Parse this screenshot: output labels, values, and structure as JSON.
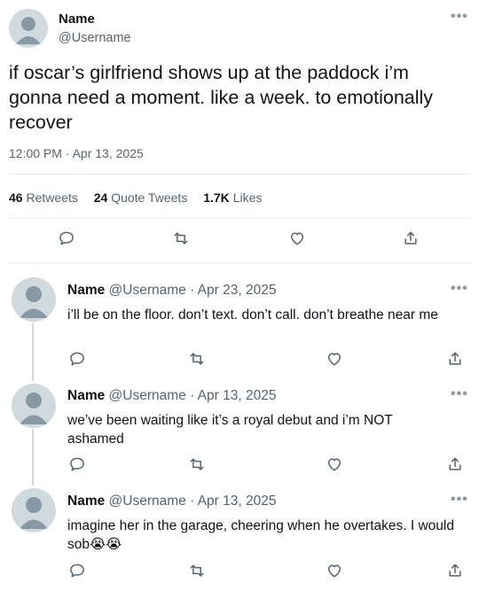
{
  "main_tweet": {
    "name": "Name",
    "username": "@Username",
    "text": "if oscar’s girlfriend shows up at the paddock i’m gonna need a moment. like a week. to emotionally recover",
    "timestamp": "12:00 PM · Apr 13, 2025",
    "stats": {
      "retweets_count": "46",
      "retweets_label": "Retweets",
      "quotes_count": "24",
      "quotes_label": "Quote Tweets",
      "likes_count": "1.7K",
      "likes_label": "Likes"
    },
    "more_label": "•••"
  },
  "replies": [
    {
      "name": "Name",
      "meta": "@Username · Apr 23, 2025",
      "text": "i’ll be on the floor. don’t text. don’t call. don’t breathe near me",
      "more_label": "•••"
    },
    {
      "name": "Name",
      "meta": "@Username · Apr 13, 2025",
      "text": "we’ve been waiting like it’s a royal debut and i’m NOT ashamed",
      "more_label": "•••"
    },
    {
      "name": "Name",
      "meta": "@Username · Apr 13, 2025",
      "text": "imagine her in the garage, cheering when he overtakes. I would sob",
      "emoji": "😭😭",
      "more_label": "•••"
    }
  ],
  "icons": {
    "reply": "comment-icon",
    "retweet": "retweet-icon",
    "like": "heart-icon",
    "share": "share-icon",
    "more": "more-icon"
  },
  "colors": {
    "text": "#0f1419",
    "muted": "#536471",
    "divider": "#e6ecf0",
    "avatar": "#cfd9de",
    "avatar_figure": "#8899a6"
  }
}
